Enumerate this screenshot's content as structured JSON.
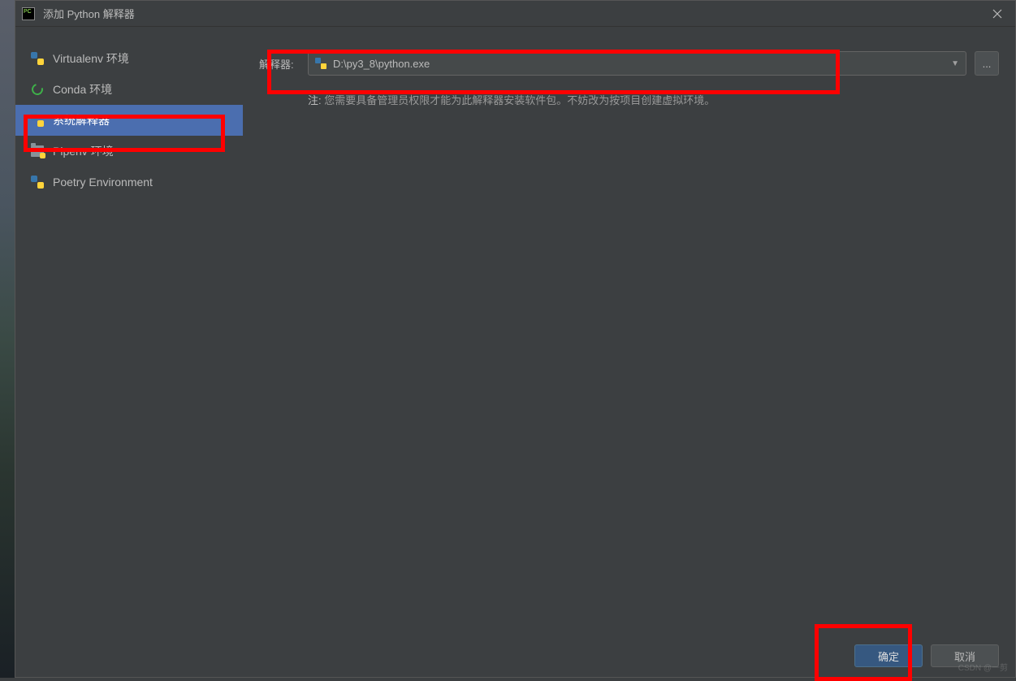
{
  "titlebar": {
    "title": "添加 Python 解释器"
  },
  "sidebar": {
    "items": [
      {
        "label": "Virtualenv 环境",
        "icon": "python-icon"
      },
      {
        "label": "Conda 环境",
        "icon": "conda-icon"
      },
      {
        "label": "系统解释器",
        "icon": "python-icon",
        "selected": true
      },
      {
        "label": "Pipenv 环境",
        "icon": "folder-python-icon"
      },
      {
        "label": "Poetry Environment",
        "icon": "python-icon"
      }
    ]
  },
  "main": {
    "interpreter_label": "解释器:",
    "interpreter_path": "D:\\py3_8\\python.exe",
    "browse_button": "...",
    "note_prefix": "注:",
    "note_text": " 您需要具备管理员权限才能为此解释器安装软件包。不妨改为按项目创建虚拟环境。"
  },
  "footer": {
    "ok_label": "确定",
    "cancel_label": "取消"
  },
  "watermark": "CSDN @一剪"
}
